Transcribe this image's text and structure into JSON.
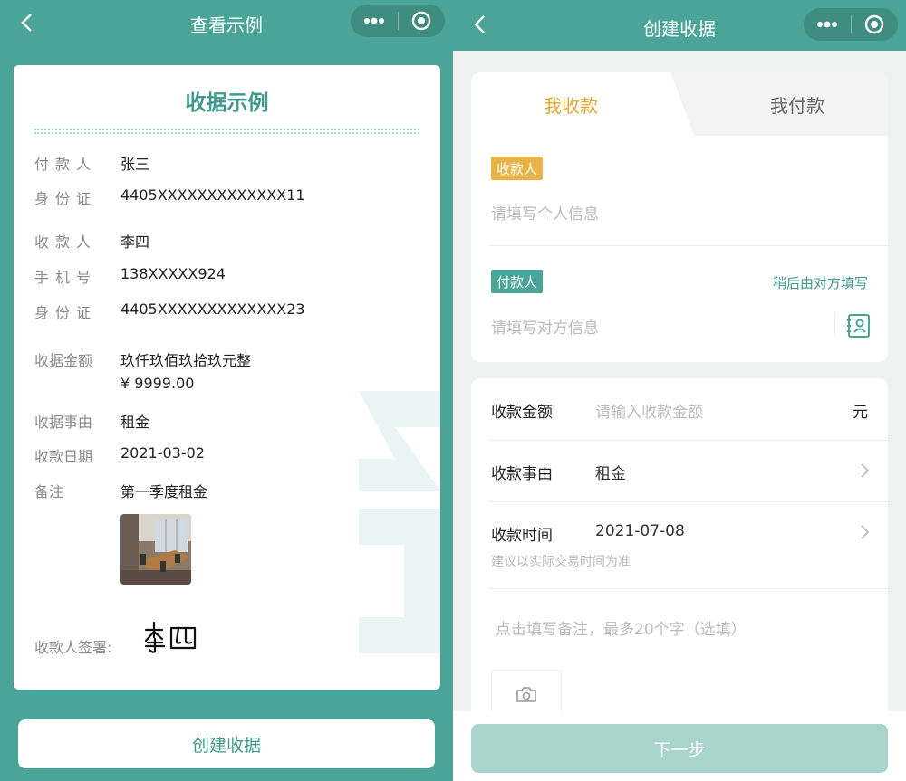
{
  "left": {
    "nav_title": "查看示例",
    "card_title": "收据示例",
    "rows": [
      {
        "label": "付款人",
        "value": "张三"
      },
      {
        "label": "身份证",
        "value": "4405XXXXXXXXXXXXX11"
      },
      {
        "label": "收款人",
        "value": "李四"
      },
      {
        "label": "手机号",
        "value": "138XXXXX924"
      },
      {
        "label": "身份证",
        "value": "4405XXXXXXXXXXXXX23"
      },
      {
        "label": "收据金额",
        "value": "玖仟玖佰玖拾玖元整"
      },
      {
        "label": "",
        "value": "¥ 9999.00"
      },
      {
        "label": "收据事由",
        "value": "租金"
      },
      {
        "label": "收款日期",
        "value": "2021-03-02"
      },
      {
        "label": "备注",
        "value": "第一季度租金"
      }
    ],
    "signature_label": "收款人签署:",
    "signature_name": "李四",
    "create_button": "创建收据"
  },
  "right": {
    "nav_title": "创建收据",
    "tab_active": "我收款",
    "tab_inactive": "我付款",
    "payee_badge": "收款人",
    "payee_placeholder": "请填写个人信息",
    "payer_badge": "付款人",
    "payer_later": "稍后由对方填写",
    "payer_placeholder": "请填写对方信息",
    "amount_label": "收款金额",
    "amount_placeholder": "请输入收款金额",
    "amount_unit": "元",
    "reason_label": "收款事由",
    "reason_value": "租金",
    "time_label": "收款时间",
    "time_value": "2021-07-08",
    "time_hint": "建议以实际交易时间为准",
    "note_placeholder": "点击填写备注，最多20个字（选填）",
    "next_button": "下一步"
  },
  "colors": {
    "brand": "#4aa598",
    "accent_yellow": "#e4a92c",
    "next_disabled": "#a9d3cd"
  },
  "icons": [
    "back-arrow-icon",
    "more-dots-icon",
    "target-icon",
    "contact-card-icon",
    "chevron-right-icon",
    "camera-icon"
  ]
}
